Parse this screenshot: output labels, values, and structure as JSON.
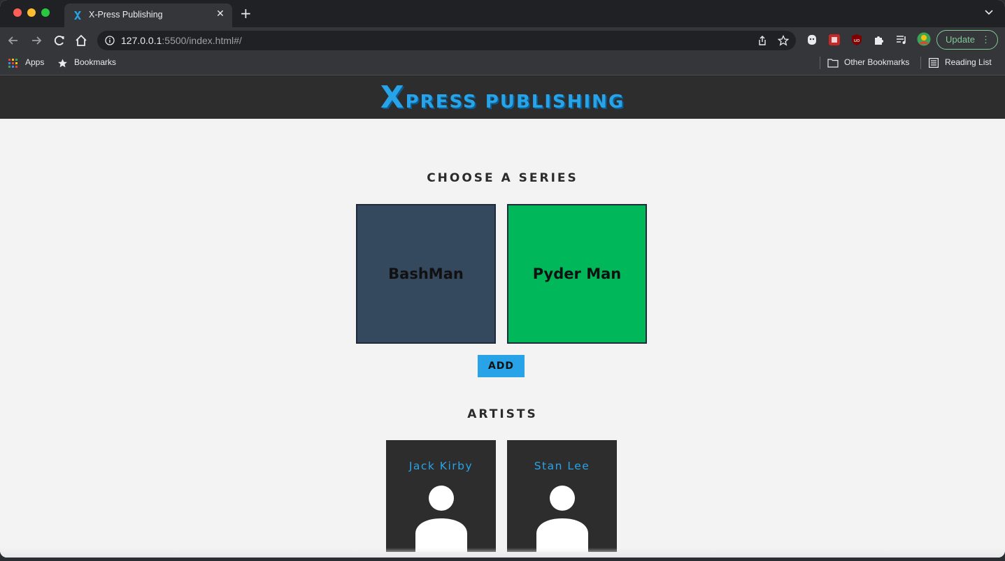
{
  "browser": {
    "tab_title": "X-Press Publishing",
    "tab_close": "✕",
    "new_tab": "+",
    "url_host": "127.0.0.1",
    "url_rest": ":5500/index.html#/",
    "update_label": "Update",
    "update_menu": "⋮",
    "bookmarks": {
      "apps": "Apps",
      "bookmarks": "Bookmarks",
      "other_bookmarks": "Other Bookmarks",
      "reading_list": "Reading List"
    }
  },
  "site": {
    "logo_first": "X",
    "logo_rest": "press publishing",
    "series_heading": "CHOOSE A SERIES",
    "series": [
      {
        "name": "BashMan",
        "color": "#34495e"
      },
      {
        "name": "Pyder Man",
        "color": "#00b85a"
      }
    ],
    "add_label": "ADD",
    "artists_heading": "ARTISTS",
    "artists": [
      {
        "name": "Jack Kirby"
      },
      {
        "name": "Stan Lee"
      }
    ]
  },
  "colors": {
    "accent": "#29a3e8",
    "header_bg": "#2d2d2d",
    "page_bg": "#f3f3f3"
  }
}
